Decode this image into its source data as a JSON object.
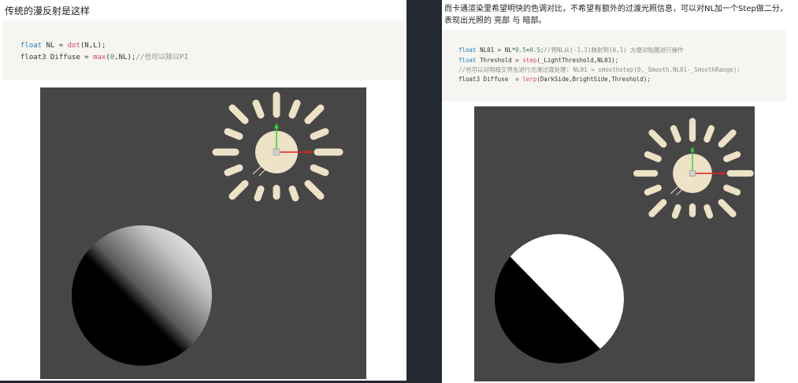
{
  "left": {
    "heading": "传统的漫反射是这样",
    "code": {
      "line1": {
        "kw": "float",
        "a": " NL = ",
        "fn": "dot",
        "b": "(N,L);"
      },
      "line2": {
        "a": "float3 Diffuse = ",
        "fn": "max",
        "b": "(",
        "num": "0",
        "c": ",NL);",
        "comment": "//也可以除以PI"
      }
    }
  },
  "right": {
    "heading": "而卡通渲染里希望明快的色调对比，不希望有额外的过渡光照信息，可以对NL加一个Step做二分，表现出光照的 亮部 与 暗部。",
    "code": {
      "line1": {
        "kw": "float",
        "a": " NL01 = NL*",
        "n1": "0.5",
        "b": "+",
        "n2": "0.5",
        "c": ";",
        "comment": "//将NL从(-1,1)映射到(0,1) 方便对贴图进行操作"
      },
      "line2": {
        "kw": "float",
        "a": " Threshold = ",
        "fn": "step",
        "b": "(_LightThreshold,NL01);"
      },
      "line3": {
        "comment": "//也可以对明暗交界先进行光滑过渡处理: NL01 = smoothstep(0,_Smooth,NL01-_SmoothRange);"
      },
      "line4": {
        "a": "float3 Diffuse  = ",
        "fn": "lerp",
        "b": "(DarkSide,BrightSide,Threshold);"
      }
    }
  },
  "colors": {
    "viewport_bg": "#464646",
    "sun": "#ede1c6",
    "gizmo_y": "#2fd12f",
    "gizmo_x": "#e02020"
  }
}
